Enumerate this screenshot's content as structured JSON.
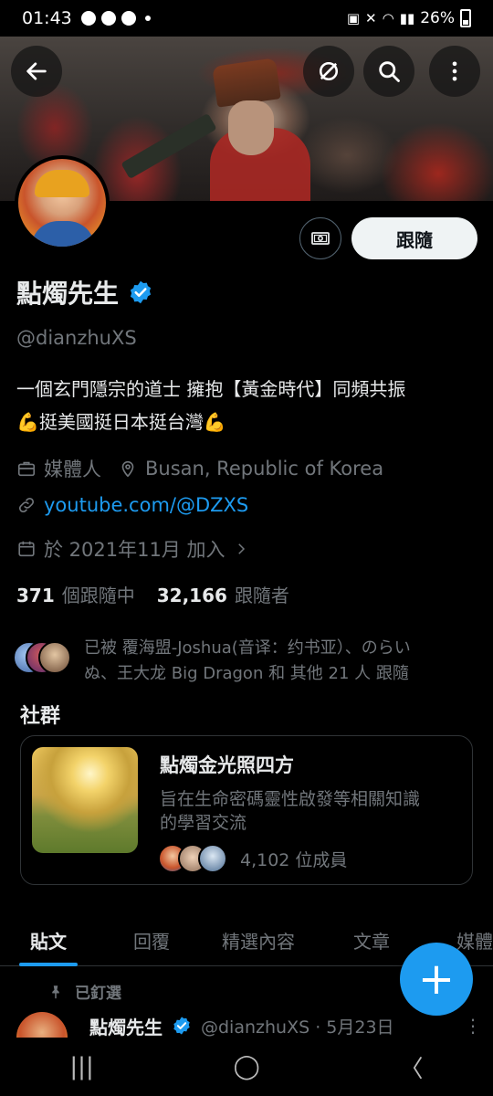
{
  "status_bar": {
    "time": "01:43",
    "battery": "26%"
  },
  "profile": {
    "name": "點燭先生",
    "handle": "@dianzhuXS",
    "bio_line1": "一個玄門隱宗的道士 擁抱【黃金時代】同頻共振",
    "bio_line2": "💪挺美國挺日本挺台灣💪",
    "follow_label": "跟隨",
    "profession": "媒體人",
    "location": "Busan, Republic of Korea",
    "link": "youtube.com/@DZXS",
    "joined": "於 2021年11月 加入",
    "following_count": "371",
    "following_label": "個跟隨中",
    "followers_count": "32,166",
    "followers_label": "跟隨者",
    "followed_by_line1": "已被 覆海盟-Joshua(音译：约书亚）、のらい",
    "followed_by_line2": "ぬ、王大龙 Big Dragon 和 其他 21 人 跟隨"
  },
  "community_section": {
    "title": "社群",
    "name": "點燭金光照四方",
    "desc_line1": "旨在生命密碼靈性啟發等相關知識",
    "desc_line2": "的學習交流",
    "members": "4,102 位成員"
  },
  "tabs": [
    "貼文",
    "回覆",
    "精選內容",
    "文章",
    "媒體"
  ],
  "pinned": {
    "label": "已釘選",
    "author": "點燭先生",
    "handle_date": "@dianzhuXS · 5月23日"
  },
  "icons": {
    "back": "arrow-left-icon",
    "grok": "grok-icon",
    "search": "search-icon",
    "more": "more-vertical-icon"
  },
  "colors": {
    "accent": "#1d9bf0",
    "background": "#000000",
    "text": "#e7e9ea",
    "muted": "#71767b"
  }
}
